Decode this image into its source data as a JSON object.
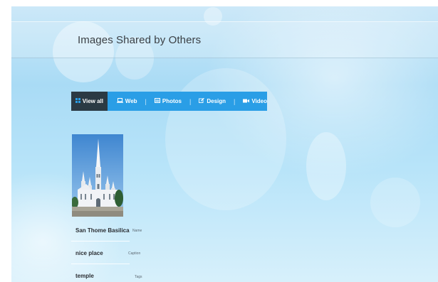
{
  "page": {
    "title": "Images Shared by Others"
  },
  "filters": [
    {
      "label": "View all",
      "icon": "grid-icon",
      "active": true
    },
    {
      "label": "Web",
      "icon": "laptop-icon",
      "active": false
    },
    {
      "label": "Photos",
      "icon": "photo-icon",
      "active": false
    },
    {
      "label": "Design",
      "icon": "edit-icon",
      "active": false
    },
    {
      "label": "Video",
      "icon": "video-camera-icon",
      "active": false
    }
  ],
  "colors": {
    "filter_bar": "#2a9ee6",
    "filter_active": "#2b3a44"
  },
  "image_card": {
    "image_subject": "white gothic church with tall spire under blue sky",
    "name_value": "San Thome Basilica",
    "name_label": "Name",
    "caption_value": "nice place",
    "caption_label": "Caption",
    "tags_value": "temple",
    "tags_label": "Tags"
  }
}
